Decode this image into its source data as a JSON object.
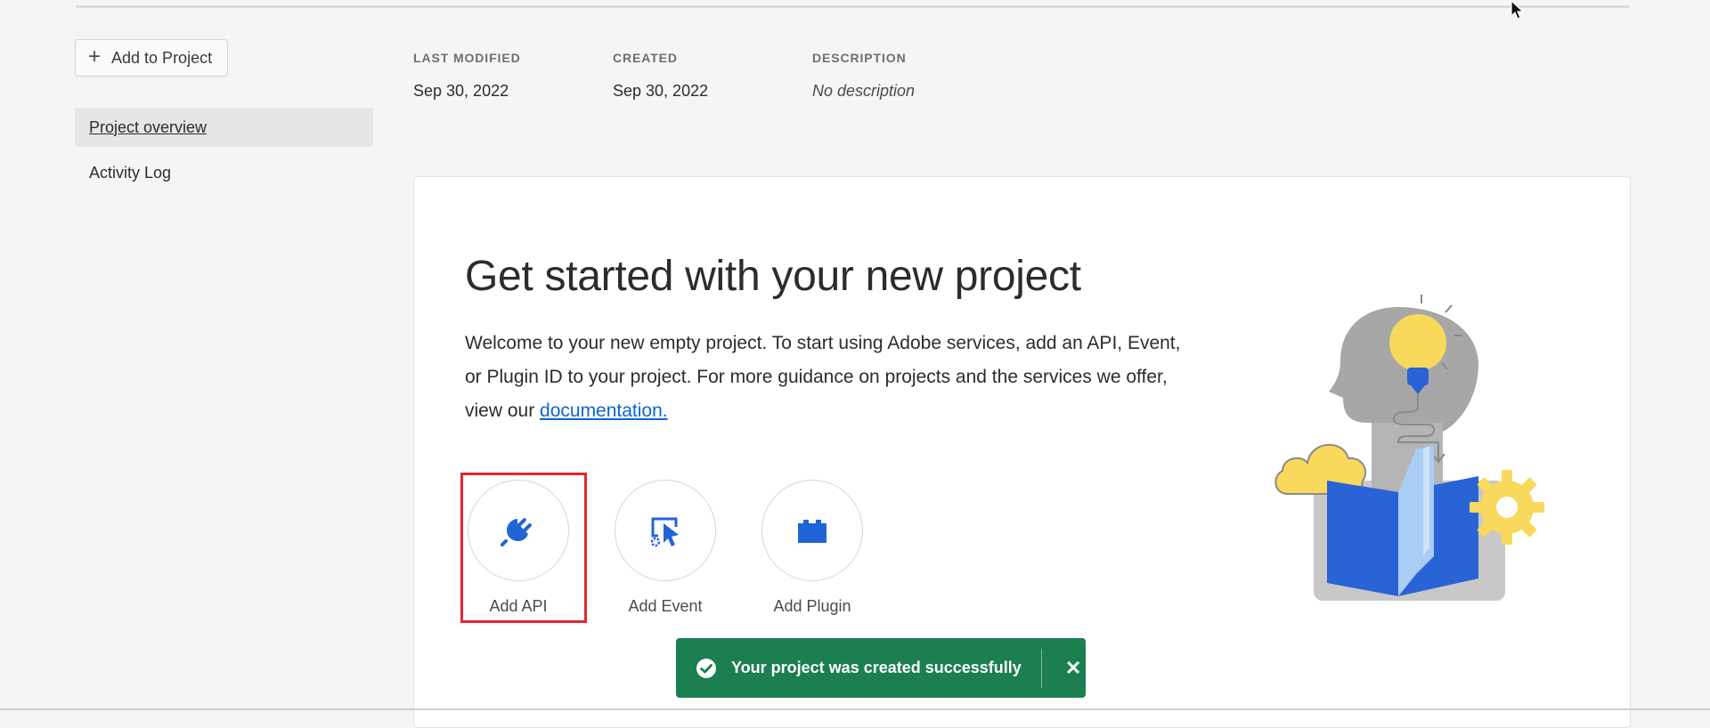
{
  "sidebar": {
    "add_button_label": "Add to Project",
    "items": [
      {
        "label": "Project overview",
        "active": true
      },
      {
        "label": "Activity Log",
        "active": false
      }
    ]
  },
  "meta": {
    "last_modified": {
      "label": "LAST MODIFIED",
      "value": "Sep 30, 2022"
    },
    "created": {
      "label": "CREATED",
      "value": "Sep 30, 2022"
    },
    "description": {
      "label": "DESCRIPTION",
      "value": "No description"
    }
  },
  "card": {
    "title": "Get started with your new project",
    "body_text": "Welcome to your new empty project. To start using Adobe services, add an API, Event, or Plugin ID to your project. For more guidance on projects and the services we offer, view our ",
    "link_text": "documentation.",
    "actions": [
      {
        "label": "Add API",
        "icon": "plug-icon"
      },
      {
        "label": "Add Event",
        "icon": "event-icon"
      },
      {
        "label": "Add Plugin",
        "icon": "plugin-icon"
      }
    ]
  },
  "toast": {
    "message": "Your project was created successfully",
    "icon": "checkmark-circle-icon",
    "close_icon": "close-icon"
  },
  "colors": {
    "accent_blue": "#1f65d6",
    "link_blue": "#0d66d0",
    "toast_green": "#1b7f4f",
    "highlight_red": "#e3282f"
  }
}
